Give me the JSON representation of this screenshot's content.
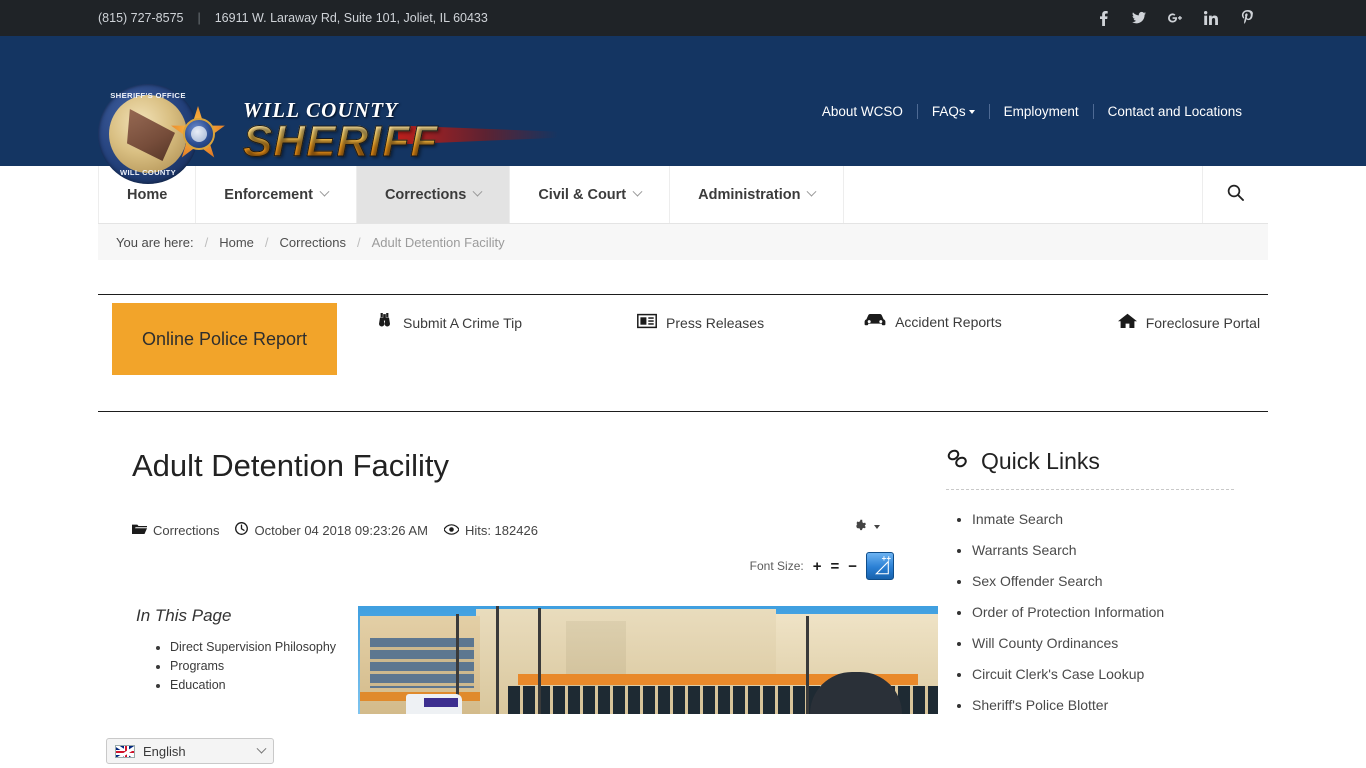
{
  "topbar": {
    "phone": "(815) 727-8575",
    "divider": "|",
    "address": "16911 W. Laraway Rd, Suite 101, Joliet, IL 60433",
    "socials": [
      {
        "name": "facebook-icon",
        "glyph": "f"
      },
      {
        "name": "twitter-icon",
        "glyph": "t"
      },
      {
        "name": "google-plus-icon",
        "glyph": "G+"
      },
      {
        "name": "linkedin-icon",
        "glyph": "in"
      },
      {
        "name": "pinterest-icon",
        "glyph": "P"
      }
    ]
  },
  "brand": {
    "badge_ring_top": "SHERIFF'S OFFICE",
    "badge_ring_bottom": "WILL COUNTY",
    "wordmark_top": "WILL COUNTY",
    "wordmark_main": "SHERIFF"
  },
  "header_nav": [
    {
      "label": "About WCSO",
      "has_caret": false
    },
    {
      "label": "FAQs",
      "has_caret": true
    },
    {
      "label": "Employment",
      "has_caret": false
    },
    {
      "label": "Contact and Locations",
      "has_caret": false
    }
  ],
  "mainnav": {
    "items": [
      {
        "label": "Home",
        "has_chevron": false,
        "active": false
      },
      {
        "label": "Enforcement",
        "has_chevron": true,
        "active": false
      },
      {
        "label": "Corrections",
        "has_chevron": true,
        "active": true
      },
      {
        "label": "Civil & Court",
        "has_chevron": true,
        "active": false
      },
      {
        "label": "Administration",
        "has_chevron": true,
        "active": false
      }
    ],
    "search_icon": "search-icon"
  },
  "breadcrumb": {
    "label": "You are here:",
    "separator": "/",
    "items": [
      "Home",
      "Corrections"
    ],
    "current": "Adult Detention Facility"
  },
  "quick_actions": {
    "primary_button": "Online Police Report",
    "links": [
      {
        "label": "Submit A Crime Tip",
        "icon": "binoculars-icon"
      },
      {
        "label": "Press Releases",
        "icon": "newspaper-icon"
      },
      {
        "label": "Accident Reports",
        "icon": "car-icon"
      },
      {
        "label": "Foreclosure Portal",
        "icon": "home-icon"
      }
    ]
  },
  "article": {
    "title": "Adult Detention Facility",
    "category": "Corrections",
    "category_icon": "folder-open-icon",
    "date": "October 04 2018 09:23:26 AM",
    "date_icon": "clock-icon",
    "hits": "Hits: 182426",
    "hits_icon": "eye-icon",
    "gear_icon": "gear-icon",
    "font_size_label": "Font Size:",
    "font_increase": "+",
    "font_reset": "=",
    "font_decrease": "−",
    "accessibility_icon": "accessibility-icon",
    "accessibility_plus": "++",
    "in_this_page_title": "In This Page",
    "in_this_page": [
      "Direct Supervision Philosophy",
      "Programs",
      "Education"
    ],
    "photo_alt": "Adult Detention Facility building exterior"
  },
  "sidebar": {
    "title": "Quick Links",
    "title_icon": "link-chain-icon",
    "links": [
      "Inmate Search",
      "Warrants Search",
      "Sex Offender Search",
      "Order of Protection Information",
      "Will County Ordinances",
      "Circuit Clerk's Case Lookup",
      "Sheriff's Police Blotter"
    ]
  },
  "language_widget": {
    "selected": "English",
    "flag": "uk-flag-icon"
  },
  "colors": {
    "topbar_bg": "#1f2327",
    "header_bg": "#143562",
    "accent_orange": "#f2a42a",
    "accent_blue": "#2a7fd4",
    "nav_active_bg": "#e3e3e3"
  }
}
